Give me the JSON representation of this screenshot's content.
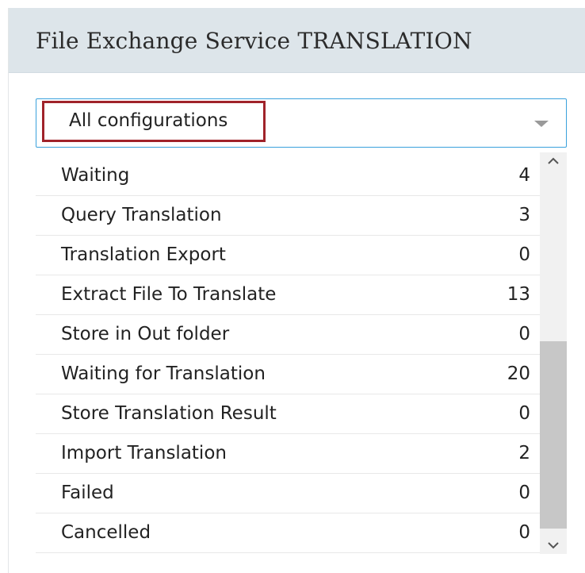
{
  "panel": {
    "title": "File Exchange Service TRANSLATION"
  },
  "filter": {
    "selected": "All configurations",
    "arrow_icon": "chevron-down-icon"
  },
  "statuses": [
    {
      "label": "Waiting",
      "count": "4"
    },
    {
      "label": "Query Translation",
      "count": "3"
    },
    {
      "label": "Translation Export",
      "count": "0"
    },
    {
      "label": "Extract File To Translate",
      "count": "13"
    },
    {
      "label": "Store in Out folder",
      "count": "0"
    },
    {
      "label": "Waiting for Translation",
      "count": "20"
    },
    {
      "label": "Store Translation Result",
      "count": "0"
    },
    {
      "label": "Import Translation",
      "count": "2"
    },
    {
      "label": "Failed",
      "count": "0"
    },
    {
      "label": "Cancelled",
      "count": "0"
    }
  ],
  "scrollbar": {
    "up_icon": "chevron-up-icon",
    "down_icon": "chevron-down-icon"
  },
  "colors": {
    "header_bg": "#dde5ea",
    "select_border": "#3aa1dc",
    "highlight_border": "#a0232a",
    "scroll_thumb": "#c7c7c7"
  }
}
